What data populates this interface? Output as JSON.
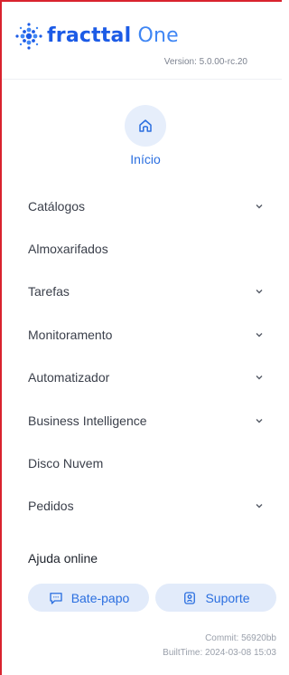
{
  "brand": {
    "name_part1": "fracttal",
    "name_part2": " One",
    "version": "Version: 5.0.00-rc.20"
  },
  "home": {
    "label": "Início",
    "icon": "home-icon"
  },
  "menu": [
    {
      "label": "Catálogos",
      "expandable": true
    },
    {
      "label": "Almoxarifados",
      "expandable": false
    },
    {
      "label": "Tarefas",
      "expandable": true
    },
    {
      "label": "Monitoramento",
      "expandable": true
    },
    {
      "label": "Automatizador",
      "expandable": true
    },
    {
      "label": "Business Intelligence",
      "expandable": true
    },
    {
      "label": "Disco Nuvem",
      "expandable": false
    },
    {
      "label": "Pedidos",
      "expandable": true
    }
  ],
  "help": {
    "title": "Ajuda online",
    "chat_label": "Bate-papo",
    "support_label": "Suporte"
  },
  "footer": {
    "commit": "Commit: 56920bb",
    "built_time": "BuiltTime: 2024-03-08 15:03"
  },
  "colors": {
    "accent": "#2b6fe0",
    "brand_dark": "#1c5be6",
    "pill_bg": "#e2ebfa",
    "frame": "#d9232e"
  }
}
